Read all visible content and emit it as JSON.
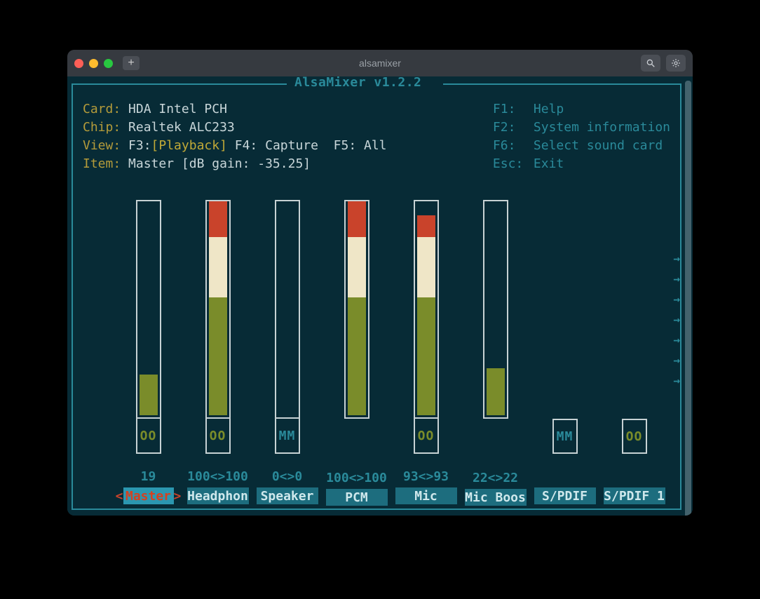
{
  "window": {
    "title": "alsamixer"
  },
  "app": {
    "frame_title": "AlsaMixer v1.2.2"
  },
  "info": {
    "card_label": "Card: ",
    "card": "HDA Intel PCH",
    "chip_label": "Chip: ",
    "chip": "Realtek ALC233",
    "view_label": "View: ",
    "view_f3": "F3:",
    "view_playback": "[Playback]",
    "view_rest": " F4: Capture  F5: All",
    "item_label": "Item: ",
    "item": "Master [dB gain: -35.25]"
  },
  "keys": [
    {
      "key": "F1:",
      "desc": "Help"
    },
    {
      "key": "F2:",
      "desc": "System information"
    },
    {
      "key": "F6:",
      "desc": "Select sound card"
    },
    {
      "key": "Esc:",
      "desc": "Exit"
    }
  ],
  "scroll": {
    "left": "<",
    "right": ">"
  },
  "channels": [
    {
      "name": "Master",
      "level": "19",
      "mute": "OO",
      "bar": true,
      "fill": 19,
      "selected": true
    },
    {
      "name": "Headphon",
      "level": "100<>100",
      "mute": "OO",
      "bar": true,
      "fill": 100,
      "selected": false
    },
    {
      "name": "Speaker",
      "level": "0<>0",
      "mute": "MM",
      "bar": true,
      "fill": 0,
      "selected": false
    },
    {
      "name": "PCM",
      "level": "100<>100",
      "mute": null,
      "bar": true,
      "fill": 100,
      "selected": false
    },
    {
      "name": "Mic",
      "level": "93<>93",
      "mute": "OO",
      "bar": true,
      "fill": 93,
      "selected": false
    },
    {
      "name": "Mic Boos",
      "level": "22<>22",
      "mute": null,
      "bar": true,
      "fill": 22,
      "selected": false
    },
    {
      "name": "S/PDIF",
      "level": "",
      "mute": "MM",
      "bar": false,
      "fill": 0,
      "selected": false
    },
    {
      "name": "S/PDIF 1",
      "level": "",
      "mute": "OO",
      "bar": false,
      "fill": 0,
      "selected": false
    }
  ],
  "arrows_count": 7
}
